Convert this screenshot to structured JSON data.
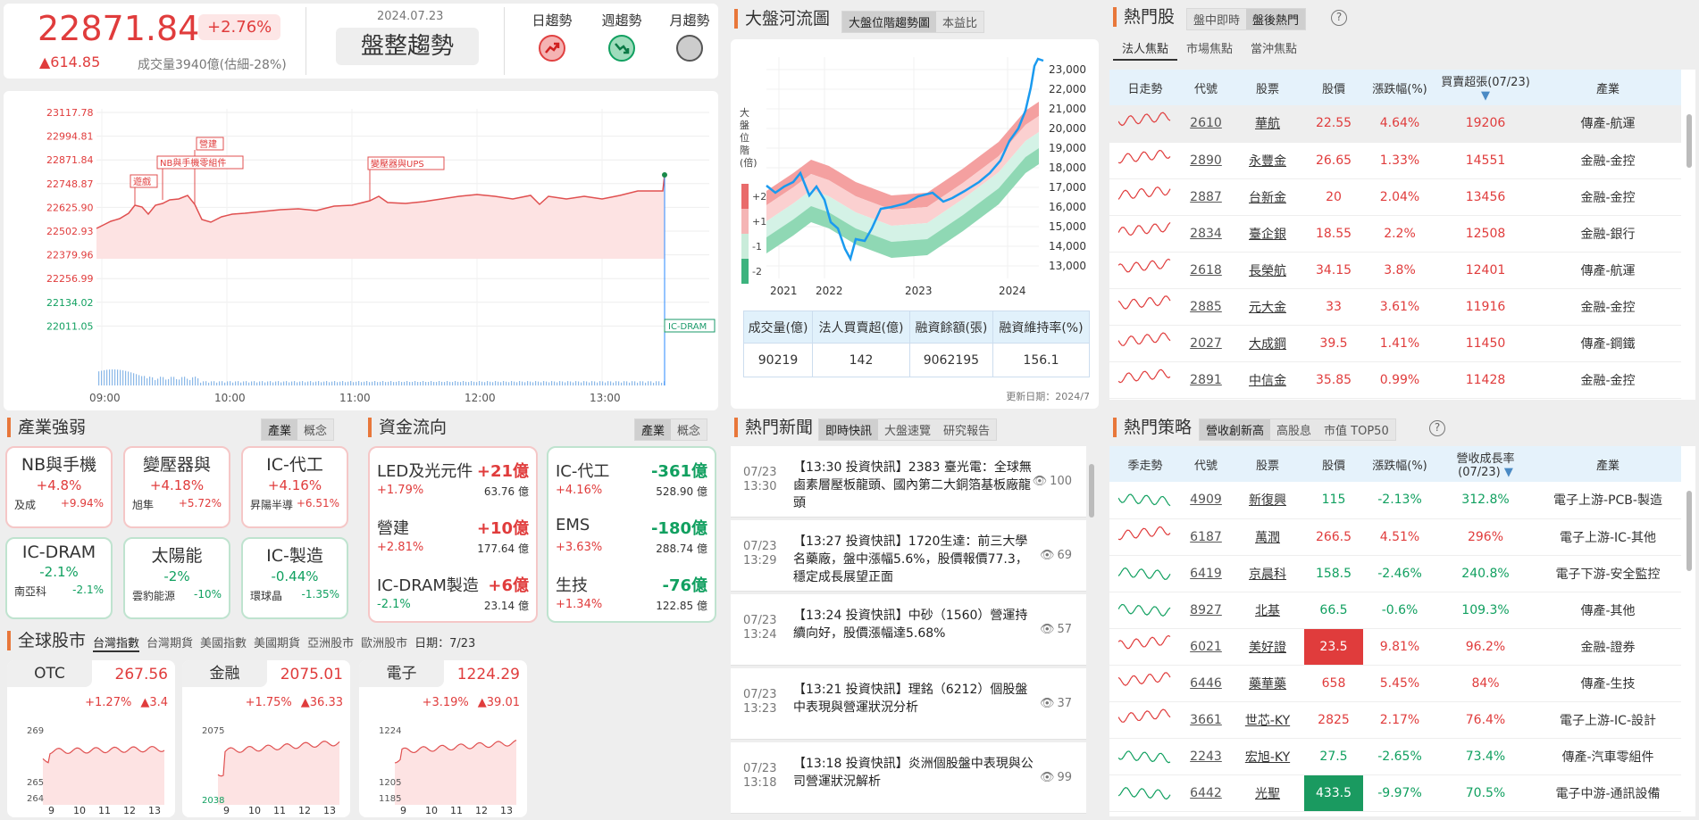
{
  "market": {
    "index": "22871.84",
    "pct": "+2.76%",
    "change": "▲614.85",
    "volume": "成交量3940億(估細-28%)",
    "date": "2024.07.23",
    "trend_label": "盤整趨勢",
    "trend_heads": [
      "日趨勢",
      "週趨勢",
      "月趨勢"
    ]
  },
  "intraday": {
    "yticks": [
      "23117.78",
      "22994.81",
      "22871.84",
      "22748.87",
      "22625.90",
      "22502.93",
      "22379.96",
      "22256.99",
      "22134.02",
      "22011.05"
    ],
    "xticks": [
      "09:00",
      "10:00",
      "11:00",
      "12:00",
      "13:00"
    ],
    "annotations": [
      "營建",
      "NB與手機零組件",
      "遊戲",
      "變壓器與UPS"
    ],
    "right_label": "IC-DRAM"
  },
  "river": {
    "title": "大盤河流圖",
    "tabs": [
      "大盤位階趨勢圖",
      "本益比"
    ],
    "ylabel": "大盤位階(倍)",
    "bands": [
      "+2",
      "+1",
      "-1",
      "-2"
    ],
    "yticks": [
      "23,000",
      "22,000",
      "21,000",
      "20,000",
      "19,000",
      "18,000",
      "17,000",
      "16,000",
      "15,000",
      "14,000",
      "13,000"
    ],
    "xticks": [
      "2021",
      "2022",
      "2023",
      "2024"
    ],
    "table_heads": [
      "成交量(億)",
      "法人買賣超(億)",
      "融資餘額(張)",
      "融資維持率(%)"
    ],
    "table_vals": [
      "90219",
      "142",
      "9062195",
      "156.1"
    ],
    "updated": "更新日期：2024/7"
  },
  "hot": {
    "title": "熱門股",
    "tabs": [
      "盤中即時",
      "盤後熱門"
    ],
    "subtabs": [
      "法人焦點",
      "市場焦點",
      "當沖焦點"
    ],
    "heads": [
      "日走勢",
      "代號",
      "股票",
      "股價",
      "漲跌幅(%)",
      "買賣超張(07/23)",
      "產業"
    ],
    "rows": [
      [
        "2610",
        "華航",
        "22.55",
        "4.64%",
        "19206",
        "傳產-航運"
      ],
      [
        "2890",
        "永豐金",
        "26.65",
        "1.33%",
        "14551",
        "金融-金控"
      ],
      [
        "2887",
        "台新金",
        "20",
        "2.04%",
        "13456",
        "金融-金控"
      ],
      [
        "2834",
        "臺企銀",
        "18.55",
        "2.2%",
        "12508",
        "金融-銀行"
      ],
      [
        "2618",
        "長榮航",
        "34.15",
        "3.8%",
        "12401",
        "傳產-航運"
      ],
      [
        "2885",
        "元大金",
        "33",
        "3.61%",
        "11916",
        "金融-金控"
      ],
      [
        "2027",
        "大成鋼",
        "39.5",
        "1.41%",
        "11450",
        "傳產-鋼鐵"
      ],
      [
        "2891",
        "中信金",
        "35.85",
        "0.99%",
        "11428",
        "金融-金控"
      ]
    ]
  },
  "industry": {
    "title": "產業強弱",
    "tabs": [
      "產業",
      "概念"
    ],
    "cards": [
      {
        "name": "NB與手機",
        "pct": "+4.8%",
        "stock": "及成",
        "spct": "+9.94%"
      },
      {
        "name": "變壓器與",
        "pct": "+4.18%",
        "stock": "旭隼",
        "spct": "+5.72%"
      },
      {
        "name": "IC-代工",
        "pct": "+4.16%",
        "stock": "昇陽半導",
        "spct": "+6.51%"
      },
      {
        "name": "IC-DRAM",
        "pct": "-2.1%",
        "stock": "南亞科",
        "spct": "-2.1%"
      },
      {
        "name": "太陽能",
        "pct": "-2%",
        "stock": "雲豹能源",
        "spct": "-10%"
      },
      {
        "name": "IC-製造",
        "pct": "-0.44%",
        "stock": "環球晶",
        "spct": "-1.35%"
      }
    ]
  },
  "flow": {
    "title": "資金流向",
    "tabs": [
      "產業",
      "概念"
    ],
    "up": [
      {
        "name": "LED及光元件",
        "amt": "+21億",
        "pct": "+1.79%",
        "val": "63.76 億"
      },
      {
        "name": "營建",
        "amt": "+10億",
        "pct": "+2.81%",
        "val": "177.64 億"
      },
      {
        "name": "IC-DRAM製造",
        "amt": "+6億",
        "pct": "-2.1%",
        "val": "23.14 億"
      }
    ],
    "down": [
      {
        "name": "IC-代工",
        "amt": "-361億",
        "pct": "+4.16%",
        "val": "528.90 億"
      },
      {
        "name": "EMS",
        "amt": "-180億",
        "pct": "+3.63%",
        "val": "288.74 億"
      },
      {
        "name": "生技",
        "amt": "-76億",
        "pct": "+1.34%",
        "val": "122.85 億"
      }
    ]
  },
  "news": {
    "title": "熱門新聞",
    "tabs": [
      "即時快訊",
      "大盤速覽",
      "研究報告"
    ],
    "items": [
      {
        "date": "07/23",
        "time": "13:30",
        "text": "【13:30 投資快訊】2383 臺光電：全球無鹵素層壓板龍頭、國內第二大銅箔基板廠龍頭",
        "views": "100"
      },
      {
        "date": "07/23",
        "time": "13:29",
        "text": "【13:27 投資快訊】1720生達：前三大學名藥廠，盤中漲幅5.6%，股價報價77.3，穩定成長展望正面",
        "views": "69"
      },
      {
        "date": "07/23",
        "time": "13:24",
        "text": "【13:24 投資快訊】中砂（1560）營運持續向好，股價漲幅達5.68%",
        "views": "57"
      },
      {
        "date": "07/23",
        "time": "13:23",
        "text": "【13:21 投資快訊】理銘（6212）個股盤中表現與營運狀況分析",
        "views": "37"
      },
      {
        "date": "07/23",
        "time": "13:18",
        "text": "【13:18 投資快訊】炎洲個股盤中表現與公司營運狀況解析",
        "views": "99"
      }
    ]
  },
  "strategy": {
    "title": "熱門策略",
    "tabs": [
      "營收創新高",
      "高股息",
      "市值 TOP50"
    ],
    "heads": [
      "季走勢",
      "代號",
      "股票",
      "股價",
      "漲跌幅(%)",
      "營收成長率(07/23)",
      "產業"
    ],
    "rows": [
      [
        "4909",
        "新復興",
        "115",
        "-2.13%",
        "312.8%",
        "電子上游-PCB-製造"
      ],
      [
        "6187",
        "萬潤",
        "266.5",
        "4.51%",
        "296%",
        "電子上游-IC-其他"
      ],
      [
        "6419",
        "京晨科",
        "158.5",
        "-2.46%",
        "240.8%",
        "電子下游-安全監控"
      ],
      [
        "8927",
        "北基",
        "66.5",
        "-0.6%",
        "109.3%",
        "傳產-其他"
      ],
      [
        "6021",
        "美好證",
        "23.5",
        "9.81%",
        "96.2%",
        "金融-證券"
      ],
      [
        "6446",
        "藥華藥",
        "658",
        "5.45%",
        "84%",
        "傳產-生技"
      ],
      [
        "3661",
        "世芯-KY",
        "2825",
        "2.17%",
        "76.4%",
        "電子上游-IC-設計"
      ],
      [
        "2243",
        "宏旭-KY",
        "27.5",
        "-2.65%",
        "73.4%",
        "傳產-汽車零組件"
      ],
      [
        "6442",
        "光聖",
        "433.5",
        "-9.97%",
        "70.5%",
        "電子中游-通訊設備"
      ]
    ]
  },
  "global": {
    "title": "全球股市",
    "tabs": [
      "台灣指數",
      "台灣期貨",
      "美國指數",
      "美國期貨",
      "亞洲股市",
      "歐洲股市"
    ],
    "date": "日期：7/23",
    "cards": [
      {
        "name": "OTC",
        "val": "267.56",
        "pct": "+1.27%",
        "chg": "▲3.4",
        "y": [
          "269",
          "265",
          "264"
        ]
      },
      {
        "name": "金融",
        "val": "2075.01",
        "pct": "+1.75%",
        "chg": "▲36.33",
        "y": [
          "2075",
          "2038"
        ]
      },
      {
        "name": "電子",
        "val": "1224.29",
        "pct": "+3.19%",
        "chg": "▲39.01",
        "y": [
          "1224",
          "1205",
          "1185"
        ]
      }
    ],
    "xticks": [
      "9",
      "10",
      "11",
      "12",
      "13"
    ]
  }
}
